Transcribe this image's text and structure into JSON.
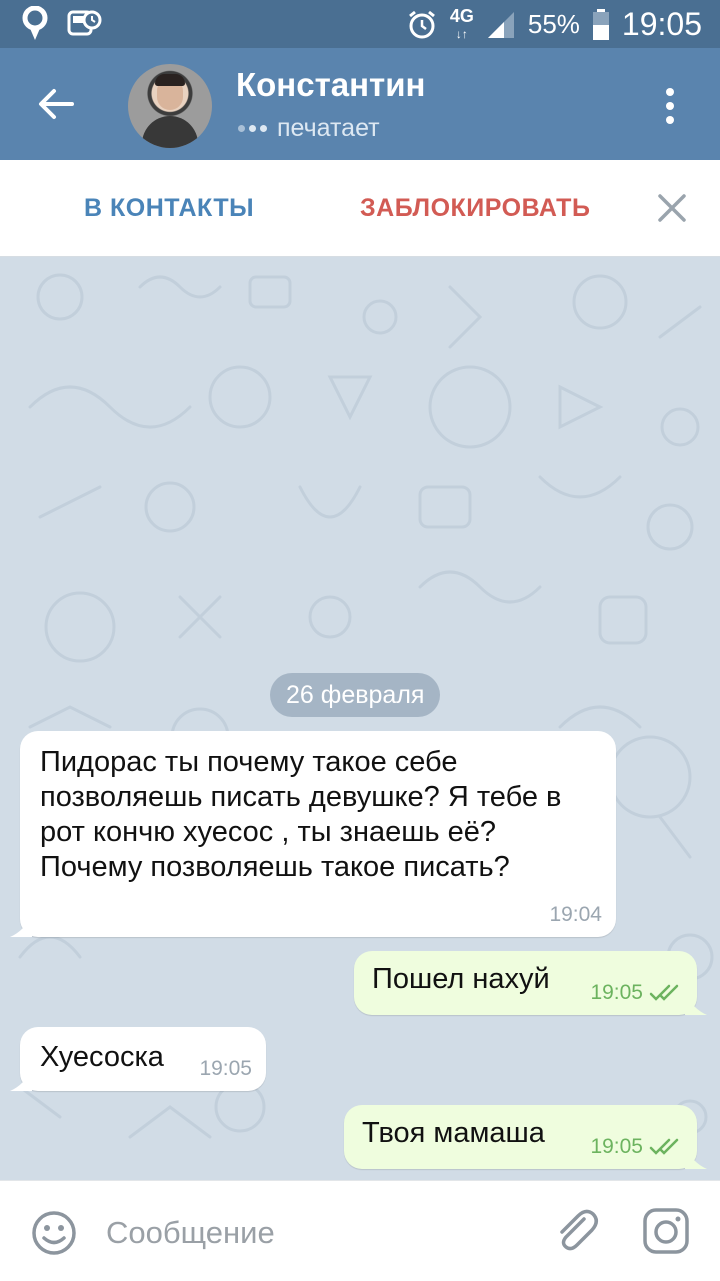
{
  "status_bar": {
    "battery": "55%",
    "network": "4G",
    "time": "19:05",
    "icons": [
      "location-icon",
      "driving-mode-icon",
      "alarm-icon",
      "network-4g-icon",
      "signal-icon",
      "battery-icon"
    ]
  },
  "header": {
    "contact_name": "Константин",
    "status": "печатает"
  },
  "action_bar": {
    "add_contact": "В КОНТАКТЫ",
    "block": "ЗАБЛОКИРОВАТЬ"
  },
  "chat": {
    "date": "26 февраля",
    "messages": [
      {
        "direction": "in",
        "text": "Пидорас ты почему такое себе позволяешь писать девушке? Я тебе в рот кончю хуесос , ты знаешь её? Почему позволяешь такое писать?",
        "time": "19:04"
      },
      {
        "direction": "out",
        "text": "Пошел нахуй",
        "time": "19:05",
        "read": true
      },
      {
        "direction": "in",
        "text": "Хуесоска",
        "time": "19:05"
      },
      {
        "direction": "out",
        "text": "Твоя мамаша",
        "time": "19:05",
        "read": true
      }
    ]
  },
  "composer": {
    "placeholder": "Сообщение"
  },
  "colors": {
    "status_bar": "#4a6f92",
    "app_bar": "#5a84ae",
    "chat_background": "#d1dce6",
    "outgoing_bubble": "#effdde",
    "incoming_bubble": "#ffffff",
    "add_contact_accent": "#4a84b8",
    "block_accent": "#d25b54",
    "read_check": "#6cb35f"
  }
}
